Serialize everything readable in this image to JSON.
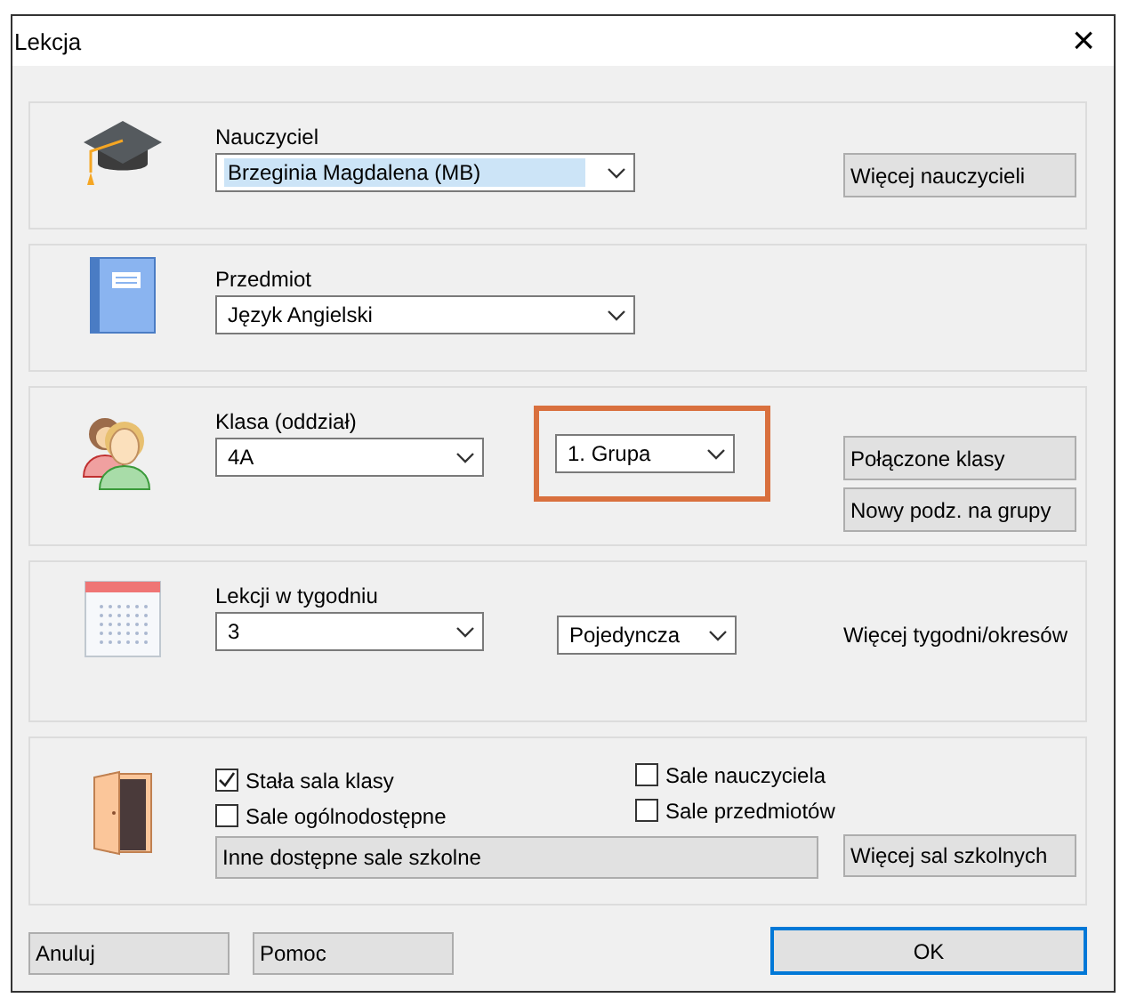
{
  "window": {
    "title": "Lekcja",
    "close": "×"
  },
  "teacher": {
    "label": "Nauczyciel",
    "value": "Brzeginia Magdalena (MB)",
    "focused": true,
    "button": "Więcej nauczycieli"
  },
  "subject": {
    "label": "Przedmiot",
    "value": "Język Angielski"
  },
  "class": {
    "label": "Klasa (oddział)",
    "value": "4A",
    "group": {
      "value": "1. Grupa",
      "highlighted": true
    },
    "buttons": [
      "Połączone klasy",
      "Nowy podz. na grupy"
    ]
  },
  "lessons": {
    "label": "Lekcji w tygodniu",
    "value": "3",
    "type": "Pojedyncza",
    "link": "Więcej tygodni/okresów"
  },
  "rooms": {
    "checkboxes": [
      {
        "label": "Stała sala klasy",
        "checked": true
      },
      {
        "label": "Sale nauczyciela",
        "checked": false
      },
      {
        "label": "Sale ogólnodostępne",
        "checked": false
      },
      {
        "label": "Sale przedmiotów",
        "checked": false
      }
    ],
    "other_button": "Inne dostępne sale szkolne",
    "more_button": "Więcej sal szkolnych"
  },
  "buttons": [
    {
      "label": "Anuluj",
      "default": false
    },
    {
      "label": "Pomoc",
      "default": false
    },
    {
      "label": "OK",
      "default": true
    }
  ]
}
